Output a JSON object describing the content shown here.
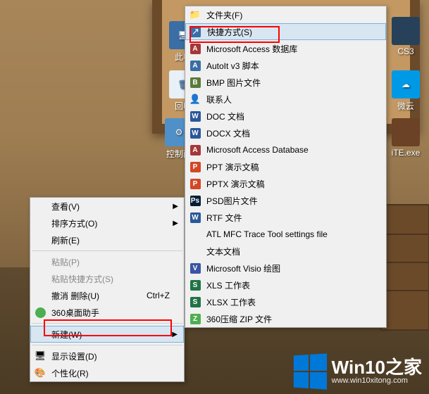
{
  "desktop": {
    "icons": [
      {
        "label": "此电",
        "color": "#3a6ea5",
        "glyph": "🖥"
      },
      {
        "label": "回收",
        "color": "#3a6ea5",
        "glyph": "🗑"
      },
      {
        "label": "控制面",
        "color": "#3a6ea5",
        "glyph": "⚙"
      },
      {
        "label": "CS3",
        "color": "#28415a",
        "glyph": ""
      },
      {
        "label": "微云",
        "color": "#0099e5",
        "glyph": "☁"
      },
      {
        "label": "iTE.exe",
        "color": "#6b4226",
        "glyph": ""
      }
    ]
  },
  "menu1": {
    "items": [
      {
        "label": "查看(V)",
        "arrow": true
      },
      {
        "label": "排序方式(O)",
        "arrow": true
      },
      {
        "label": "刷新(E)"
      },
      {
        "sep": true
      },
      {
        "label": "粘贴(P)",
        "disabled": true
      },
      {
        "label": "粘贴快捷方式(S)",
        "disabled": true
      },
      {
        "label": "撤消 删除(U)",
        "shortcut": "Ctrl+Z"
      },
      {
        "label": "360桌面助手",
        "icon": "360",
        "iconColor": "#4caf50"
      },
      {
        "sep": true
      },
      {
        "label": "新建(W)",
        "arrow": true,
        "highlight": true
      },
      {
        "sep": true
      },
      {
        "label": "显示设置(D)",
        "icon": "display",
        "iconColor": "#3a6ea5"
      },
      {
        "label": "个性化(R)",
        "icon": "personalize",
        "iconColor": "#3a6ea5"
      }
    ]
  },
  "menu2": {
    "items": [
      {
        "label": "文件夹(F)",
        "icon": "folder",
        "iconColor": "#f9d66b"
      },
      {
        "label": "快捷方式(S)",
        "icon": "shortcut",
        "iconColor": "#3a6ea5",
        "highlight": true
      },
      {
        "label": "Microsoft Access 数据库",
        "icon": "A",
        "iconColor": "#a4373a"
      },
      {
        "label": "AutoIt v3 脚本",
        "icon": "A",
        "iconColor": "#3a6ea5"
      },
      {
        "label": "BMP 图片文件",
        "icon": "B",
        "iconColor": "#5a7a3a"
      },
      {
        "label": "联系人",
        "icon": "👤",
        "iconColor": "#4a90d9"
      },
      {
        "label": "DOC 文档",
        "icon": "W",
        "iconColor": "#2b579a"
      },
      {
        "label": "DOCX 文档",
        "icon": "W",
        "iconColor": "#2b579a"
      },
      {
        "label": "Microsoft Access Database",
        "icon": "A",
        "iconColor": "#a4373a"
      },
      {
        "label": "PPT 演示文稿",
        "icon": "P",
        "iconColor": "#d24726"
      },
      {
        "label": "PPTX 演示文稿",
        "icon": "P",
        "iconColor": "#d24726"
      },
      {
        "label": "PSD图片文件",
        "icon": "Ps",
        "iconColor": "#001e36"
      },
      {
        "label": "RTF 文件",
        "icon": "W",
        "iconColor": "#2b579a"
      },
      {
        "label": "ATL MFC Trace Tool settings file",
        "icon": "",
        "iconColor": "#ddd"
      },
      {
        "label": "文本文档",
        "icon": "",
        "iconColor": "#ddd"
      },
      {
        "label": "Microsoft Visio 绘图",
        "icon": "V",
        "iconColor": "#3955a3"
      },
      {
        "label": "XLS 工作表",
        "icon": "S",
        "iconColor": "#217346"
      },
      {
        "label": "XLSX 工作表",
        "icon": "S",
        "iconColor": "#217346"
      },
      {
        "label": "360压缩 ZIP 文件",
        "icon": "Z",
        "iconColor": "#4caf50"
      }
    ]
  },
  "watermark": {
    "title": "Win10之家",
    "url": "www.win10xitong.com"
  },
  "colors": {
    "highlight": "#d8e6f2",
    "highlightBorder": "#7cb4dc",
    "redbox": "#ff0000",
    "winblue": "#0078d7"
  }
}
